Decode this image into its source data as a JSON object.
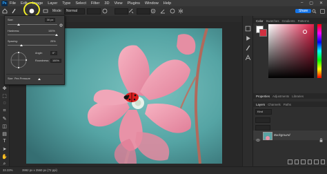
{
  "menu": {
    "logo": "Ps",
    "items": [
      "File",
      "Edit",
      "Image",
      "Layer",
      "Type",
      "Select",
      "Filter",
      "3D",
      "View",
      "Plugins",
      "Window",
      "Help"
    ],
    "window_controls": [
      "–",
      "▢",
      "✕"
    ]
  },
  "options_bar": {
    "mode_label": "Mode:",
    "mode_value": "Normal",
    "opacity_label": "",
    "share_label": "Share"
  },
  "brush_panel": {
    "size_label": "Size:",
    "size_value": "30 px",
    "hardness_label": "Hardness:",
    "hardness_value": "100%",
    "spacing_label": "Spacing:",
    "spacing_value": "25%",
    "angle_label": "Angle:",
    "angle_value": "0°",
    "roundness_label": "Roundness:",
    "roundness_value": "100%",
    "size_mode_label": "Size:",
    "size_mode_value": "Pen Pressure"
  },
  "color_panel": {
    "tabs": [
      "Color",
      "Swatches",
      "Gradients",
      "Patterns"
    ],
    "foreground_color": "#ffffff",
    "hue_color": "#e0204a"
  },
  "properties_panel": {
    "tabs": [
      "Properties",
      "Adjustments",
      "Libraries"
    ]
  },
  "layers_panel": {
    "tabs": [
      "Layers",
      "Channels",
      "Paths"
    ],
    "kind_label": "Kind",
    "layer_name": "Background"
  },
  "status_bar": {
    "zoom": "33.33%",
    "doc_info": "3992 px x 2560 px (72 ppi)"
  },
  "colors": {
    "accent": "#1473e6",
    "highlight_ring": "#f2ef2a",
    "canvas_bg": "#4f9a9b"
  }
}
